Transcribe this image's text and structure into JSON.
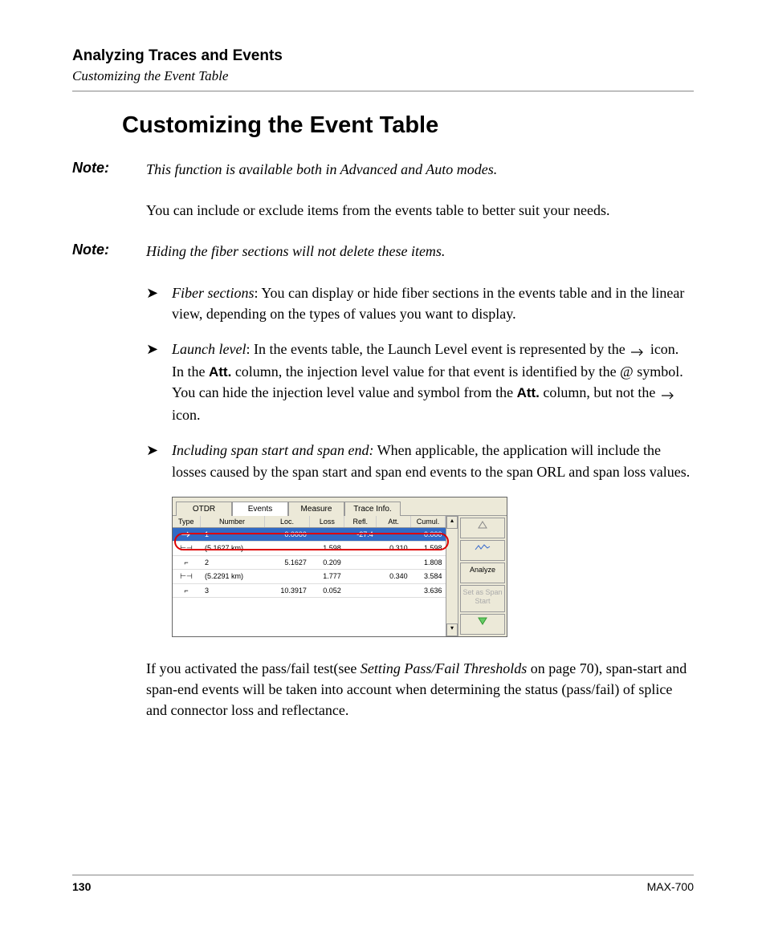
{
  "header": {
    "chapter": "Analyzing Traces and Events",
    "breadcrumb": "Customizing the Event Table"
  },
  "heading": "Customizing the Event Table",
  "note1": {
    "label": "Note:",
    "text": "This function is available both in Advanced and Auto modes."
  },
  "para1": "You can include or exclude items from the events table to better suit your needs.",
  "note2": {
    "label": "Note:",
    "text": "Hiding the fiber sections will not delete these items."
  },
  "bullets": {
    "b1": {
      "lead": "Fiber sections",
      "rest": ": You can display or hide fiber sections in the events table and in the linear view, depending on the types of values you want to display."
    },
    "b2": {
      "lead": "Launch level",
      "p1a": ": In the events table, the Launch Level event is represented by the ",
      "p1b": " icon. In the ",
      "att": "Att.",
      "p1c": " column, the injection level value for that event is identified by the @ symbol.",
      "p2a": "You can hide the injection level value and symbol from the ",
      "p2b": " column, but not the ",
      "p2c": " icon."
    },
    "b3": {
      "lead": "Including span start and span end:",
      "rest": " When applicable, the application will include the losses caused by the span start and span end events to the span ORL and span loss values."
    }
  },
  "screenshot": {
    "tabs": {
      "t1": "OTDR",
      "t2": "Events",
      "t3": "Measure",
      "t4": "Trace Info."
    },
    "columns": {
      "c1": "Type",
      "c2": "Number",
      "c3": "Loc.",
      "c4": "Loss",
      "c5": "Refl.",
      "c6": "Att.",
      "c7": "Cumul."
    },
    "rows": {
      "r1": {
        "type": "launch",
        "num": "1",
        "loc": "0.0000",
        "loss": "",
        "refl": "-27.4",
        "att": "",
        "cumul": "0.000"
      },
      "r2": {
        "type": "section",
        "num": "(5.1627 km)",
        "loc": "",
        "loss": "1.598",
        "refl": "",
        "att": "0.310",
        "cumul": "1.598"
      },
      "r3": {
        "type": "event",
        "num": "2",
        "loc": "5.1627",
        "loss": "0.209",
        "refl": "",
        "att": "",
        "cumul": "1.808"
      },
      "r4": {
        "type": "section",
        "num": "(5.2291 km)",
        "loc": "",
        "loss": "1.777",
        "refl": "",
        "att": "0.340",
        "cumul": "3.584"
      },
      "r5": {
        "type": "event",
        "num": "3",
        "loc": "10.3917",
        "loss": "0.052",
        "refl": "",
        "att": "",
        "cumul": "3.636"
      }
    },
    "side": {
      "analyze": "Analyze",
      "setas": "Set as Span Start"
    }
  },
  "para2a": "If you activated the pass/fail test(see ",
  "para2ref": "Setting Pass/Fail Thresholds",
  "para2b": " on page 70), span-start and span-end events will be taken into account when determining the status (pass/fail) of splice and connector loss and reflectance.",
  "footer": {
    "page": "130",
    "model": "MAX-700"
  }
}
